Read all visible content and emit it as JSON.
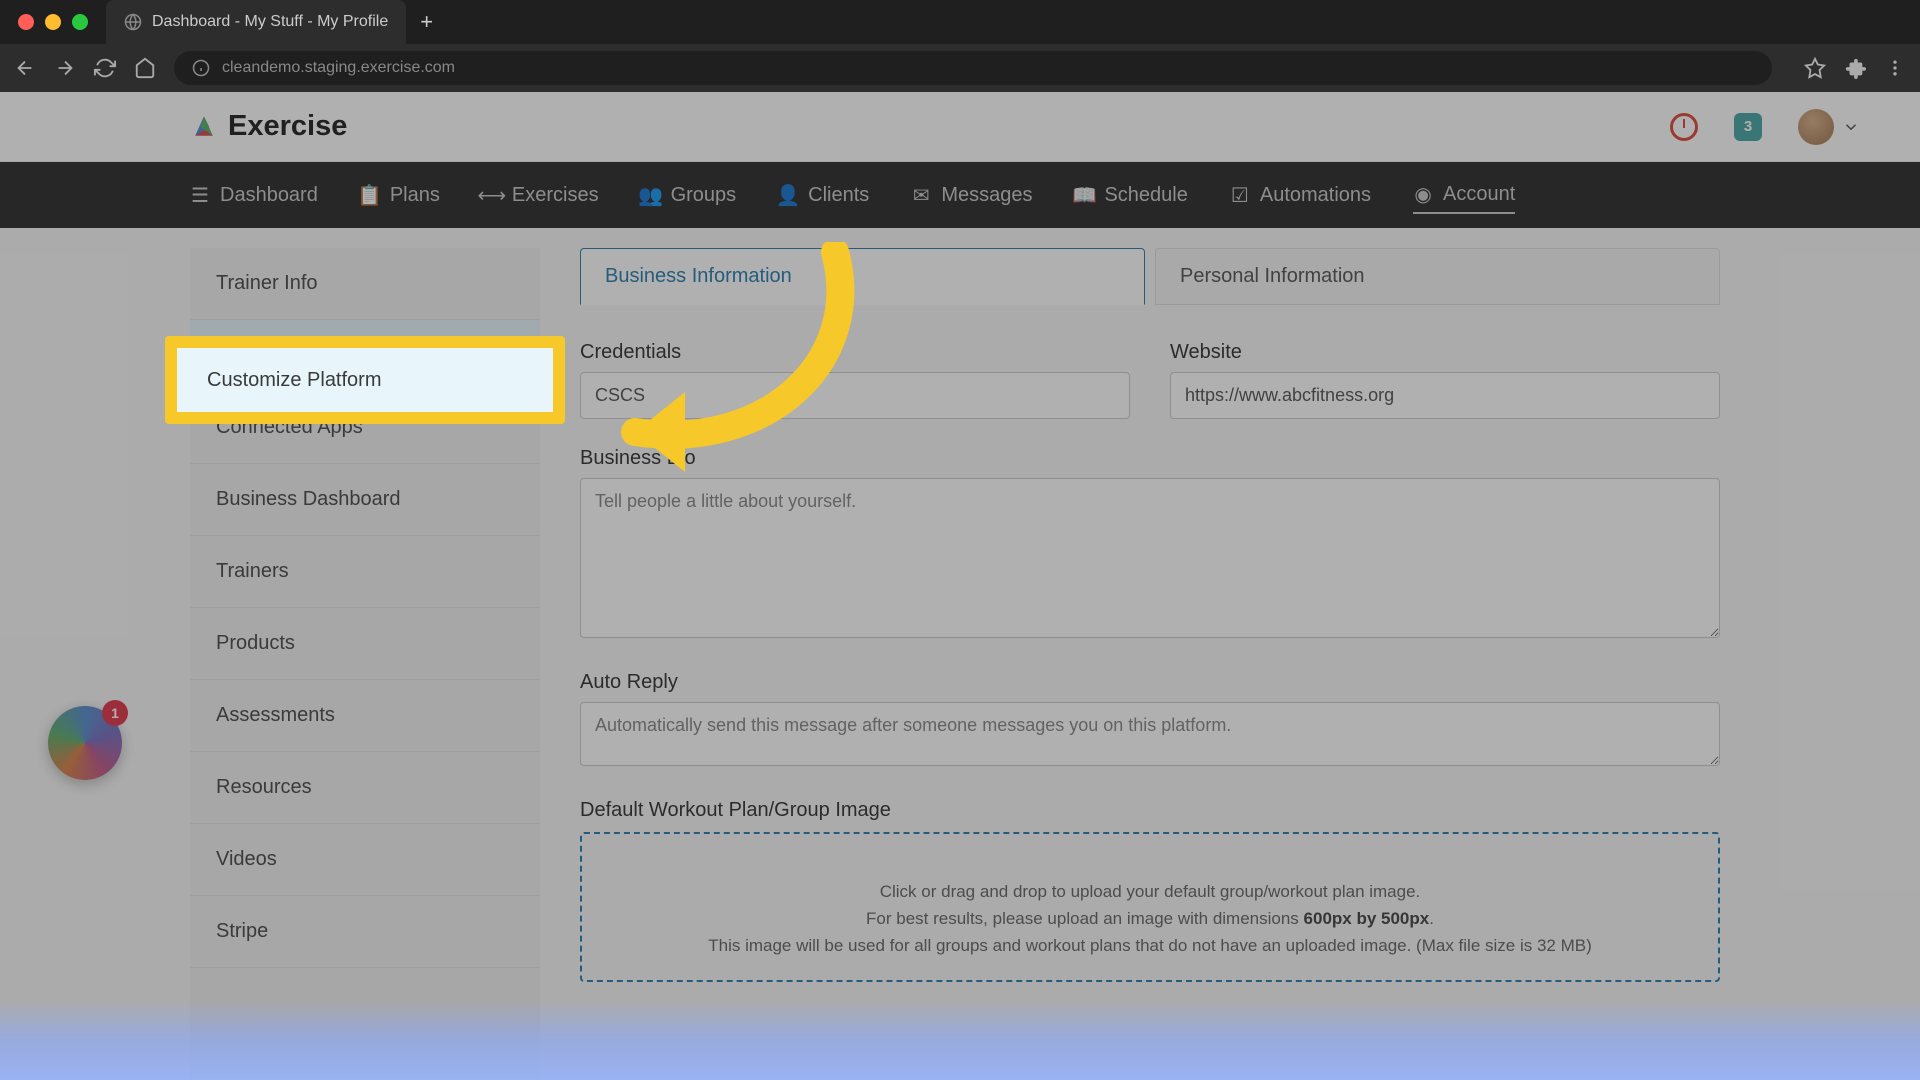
{
  "browser": {
    "tab_title": "Dashboard - My Stuff - My Profile",
    "url": "cleandemo.staging.exercise.com"
  },
  "header": {
    "logo_text": "Exercise",
    "notif_count": "3"
  },
  "nav": {
    "items": [
      {
        "label": "Dashboard"
      },
      {
        "label": "Plans"
      },
      {
        "label": "Exercises"
      },
      {
        "label": "Groups"
      },
      {
        "label": "Clients"
      },
      {
        "label": "Messages"
      },
      {
        "label": "Schedule"
      },
      {
        "label": "Automations"
      },
      {
        "label": "Account"
      }
    ]
  },
  "sidebar": {
    "items": [
      {
        "label": "Trainer Info"
      },
      {
        "label": "Customize Platform"
      },
      {
        "label": "Connected Apps"
      },
      {
        "label": "Business Dashboard"
      },
      {
        "label": "Trainers"
      },
      {
        "label": "Products"
      },
      {
        "label": "Assessments"
      },
      {
        "label": "Resources"
      },
      {
        "label": "Videos"
      },
      {
        "label": "Stripe"
      }
    ]
  },
  "tabs": {
    "business": "Business Information",
    "personal": "Personal Information"
  },
  "form": {
    "credentials_label": "Credentials",
    "credentials_value": "CSCS",
    "website_label": "Website",
    "website_value": "https://www.abcfitness.org",
    "bio_label": "Business Bio",
    "bio_placeholder": "Tell people a little about yourself.",
    "autoreply_label": "Auto Reply",
    "autoreply_placeholder": "Automatically send this message after someone messages you on this platform.",
    "image_label": "Default Workout Plan/Group Image",
    "dropzone_line1": "Click or drag and drop to upload your default group/workout plan image.",
    "dropzone_line2a": "For best results, please upload an image with dimensions ",
    "dropzone_line2b": "600px by 500px",
    "dropzone_line3": "This image will be used for all groups and workout plans that do not have an uploaded image. (Max file size is 32 MB)"
  },
  "widget": {
    "badge": "1"
  },
  "highlight_label": "Customize Platform"
}
